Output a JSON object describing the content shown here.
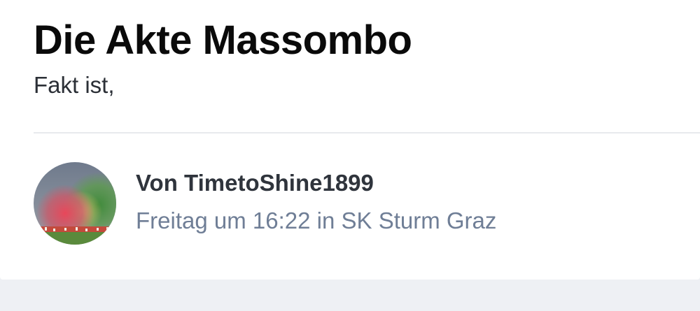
{
  "post": {
    "title": "Die Akte Massombo",
    "excerpt": "Fakt ist,"
  },
  "author": {
    "label": "Von TimetoShine1899",
    "avatar_icon": "user-avatar-stadium-pyro"
  },
  "meta": {
    "time": "Freitag um 16:22",
    "in_word": " in ",
    "forum": "SK Sturm Graz"
  },
  "colors": {
    "title": "#0a0a0a",
    "meta": "#6f7e96",
    "background": "#eef0f4",
    "card": "#ffffff"
  }
}
